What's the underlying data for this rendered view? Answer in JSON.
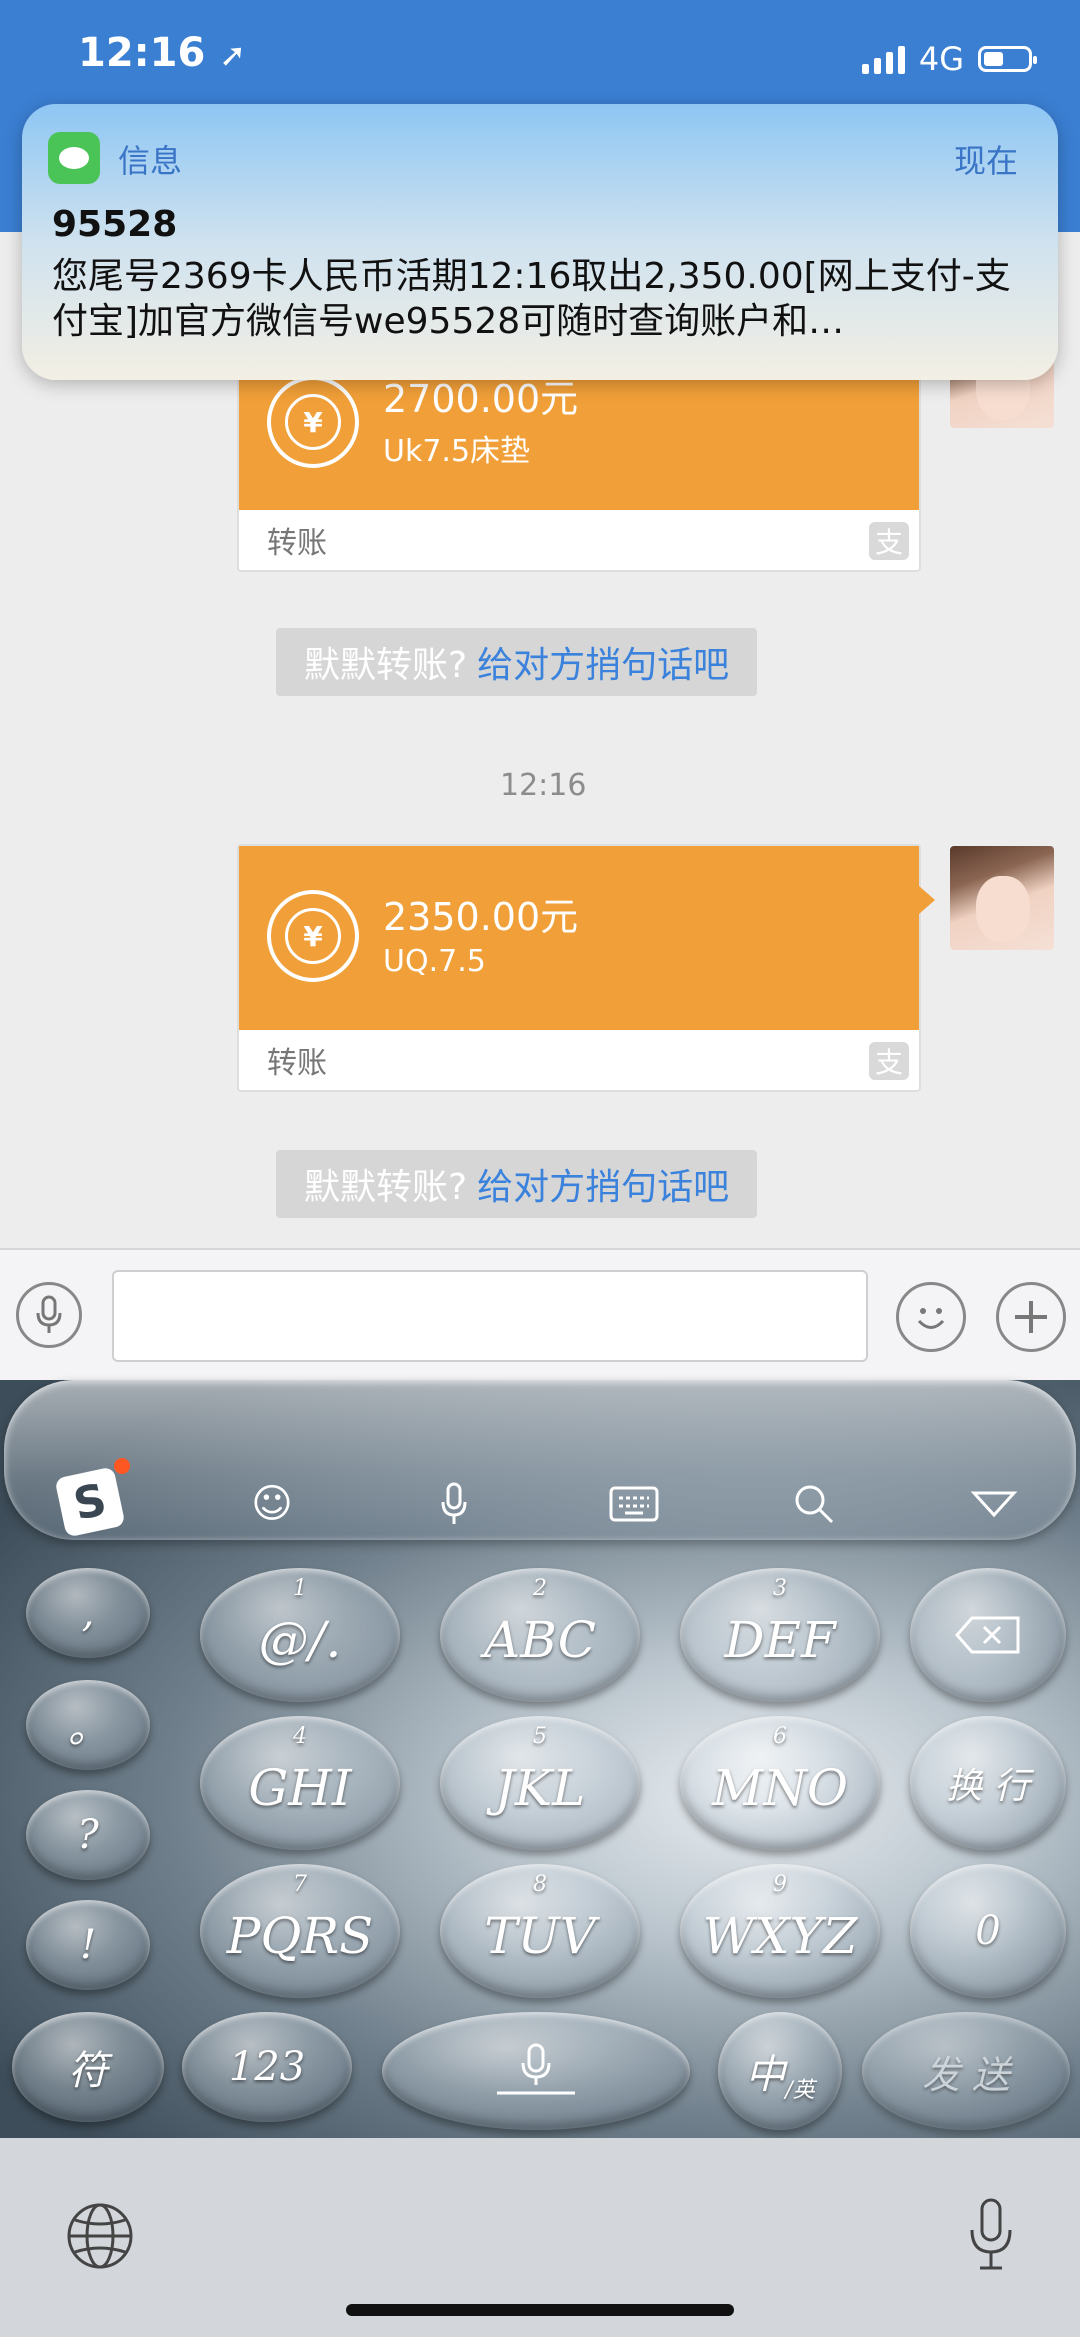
{
  "status_bar": {
    "time": "12:16",
    "network": "4G"
  },
  "notification": {
    "app_name": "信息",
    "time": "现在",
    "sender": "95528",
    "body": "您尾号2369卡人民币活期12:16取出2,350.00[网上支付-支付宝]加官方微信号we95528可随时查询账户和…"
  },
  "messages": {
    "card1": {
      "amount": "2700.00元",
      "memo": "Uk7.5床垫",
      "footer": "转账"
    },
    "hint1": {
      "grey": "默默转账?",
      "blue": "给对方捎句话吧"
    },
    "timestamp": "12:16",
    "card2": {
      "amount": "2350.00元",
      "memo": "UQ.7.5",
      "footer": "转账"
    },
    "hint2": {
      "grey": "默默转账?",
      "blue": "给对方捎句话吧"
    }
  },
  "input_bar": {
    "text": ""
  },
  "keyboard": {
    "left_column": [
      ",",
      "。",
      "?",
      "!"
    ],
    "rows": [
      {
        "num": "1",
        "label": "@/."
      },
      {
        "num": "2",
        "label": "ABC"
      },
      {
        "num": "3",
        "label": "DEF"
      },
      {
        "num": "4",
        "label": "GHI"
      },
      {
        "num": "5",
        "label": "JKL"
      },
      {
        "num": "6",
        "label": "MNO"
      },
      {
        "num": "7",
        "label": "PQRS"
      },
      {
        "num": "8",
        "label": "TUV"
      },
      {
        "num": "9",
        "label": "WXYZ"
      }
    ],
    "backspace": "⌫",
    "newline": "换 行",
    "zero": "0",
    "symbols": "符",
    "numbers": "123",
    "lang_main": "中",
    "lang_sub": "/英",
    "send": "发 送"
  }
}
